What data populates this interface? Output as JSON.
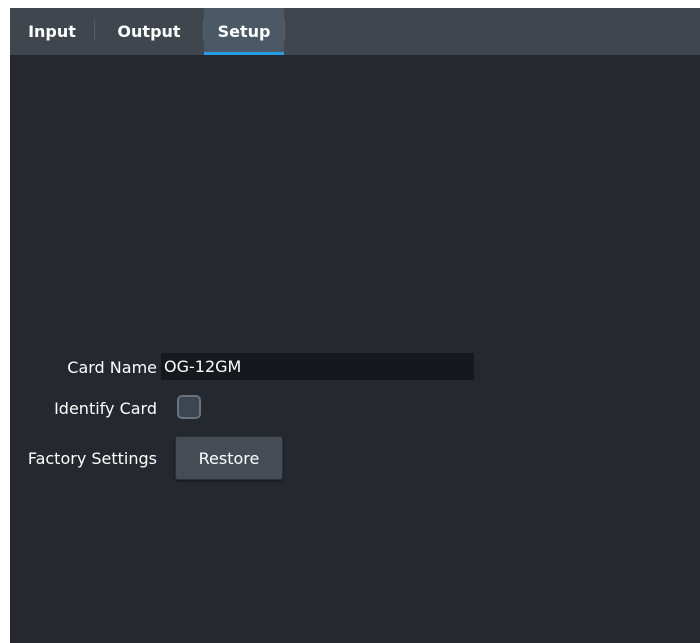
{
  "tabs": {
    "input": "Input",
    "output": "Output",
    "setup": "Setup"
  },
  "form": {
    "card_name_label": "Card Name",
    "card_name_value": "OG-12GM",
    "identify_label": "Identify Card",
    "identify_checked": false,
    "factory_label": "Factory Settings",
    "restore_label": "Restore"
  },
  "colors": {
    "background": "#25282e",
    "tabbar": "#40464e",
    "active_tab": "#4b5866",
    "active_accent": "#2c9be6"
  }
}
